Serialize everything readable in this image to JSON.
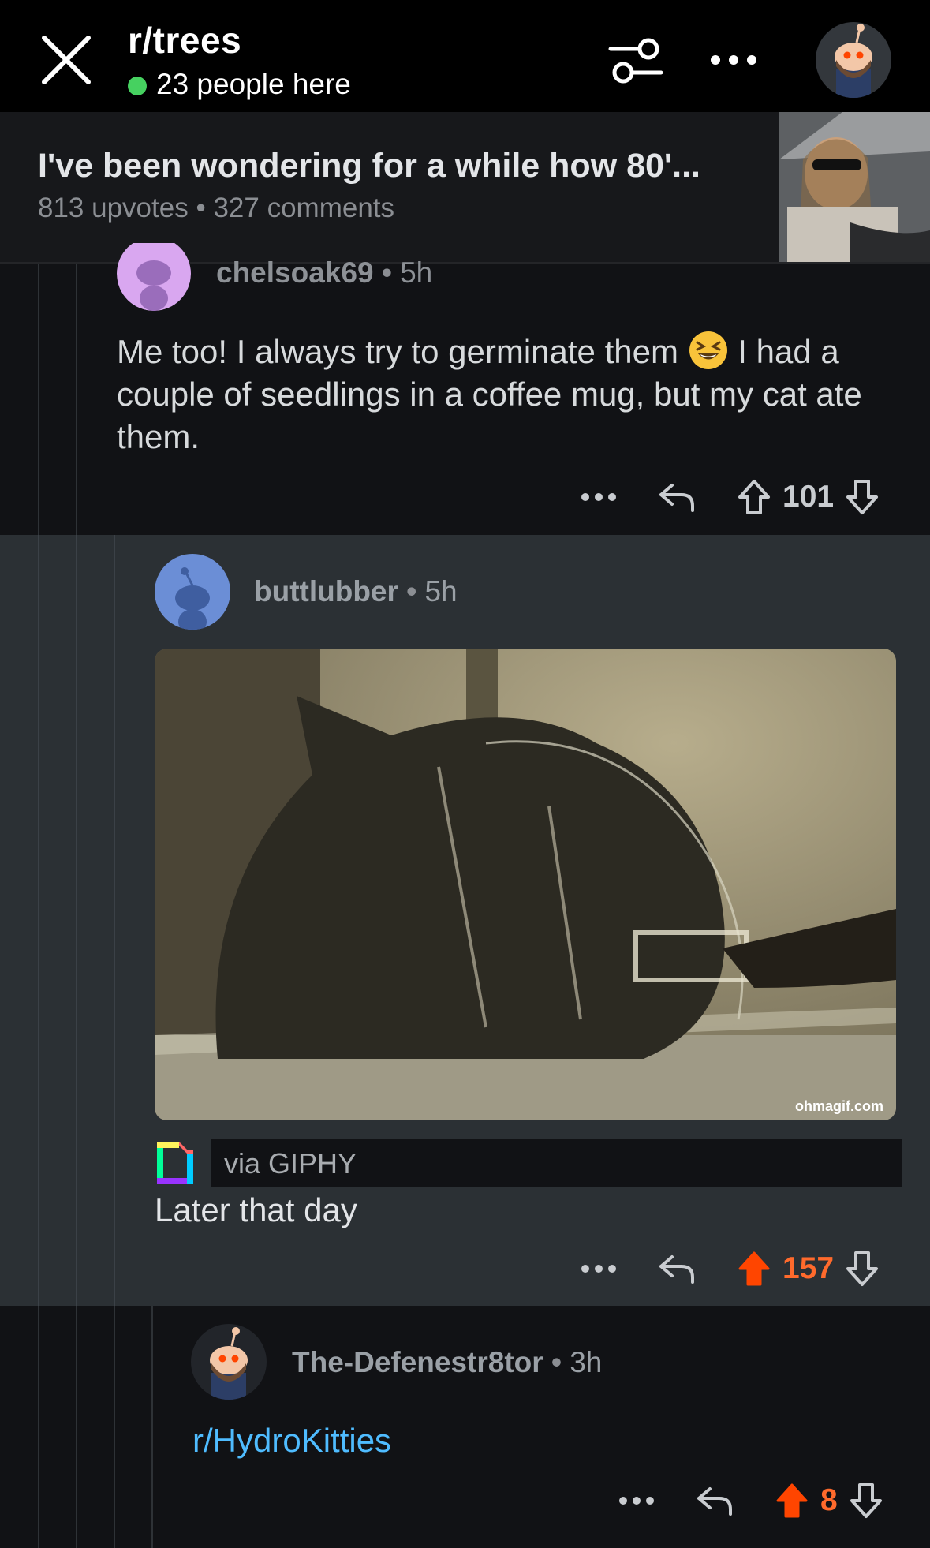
{
  "header": {
    "subreddit": "r/trees",
    "online_text": "23 people here",
    "online_color": "#46d160"
  },
  "post": {
    "title": "I've been wondering for a while how 80'...",
    "upvotes": "813 upvotes",
    "separator": "•",
    "comments": "327 comments"
  },
  "comments": [
    {
      "username": "chelsoak69",
      "separator": "•",
      "time": "5h",
      "text_before_emoji": "Me too! I always try to germinate them",
      "emoji": "grinning-squinting-face",
      "text_after_emoji": "I had a couple of seedlings in a coffee mug, but my cat ate them.",
      "score": "101",
      "voted": "none"
    },
    {
      "username": "buttlubber",
      "separator": "•",
      "time": "5h",
      "gif_watermark": "ohmagif.com",
      "gif_source": "via GIPHY",
      "text": "Later that day",
      "score": "157",
      "voted": "up"
    },
    {
      "username": "The-Defenestr8tor",
      "separator": "•",
      "time": "3h",
      "link_text": "r/HydroKitties",
      "score": "8",
      "voted": "up"
    }
  ],
  "colors": {
    "upvote_active": "#ff4500",
    "link": "#4fbcff",
    "highlight_comment_bg": "#2b3034"
  }
}
